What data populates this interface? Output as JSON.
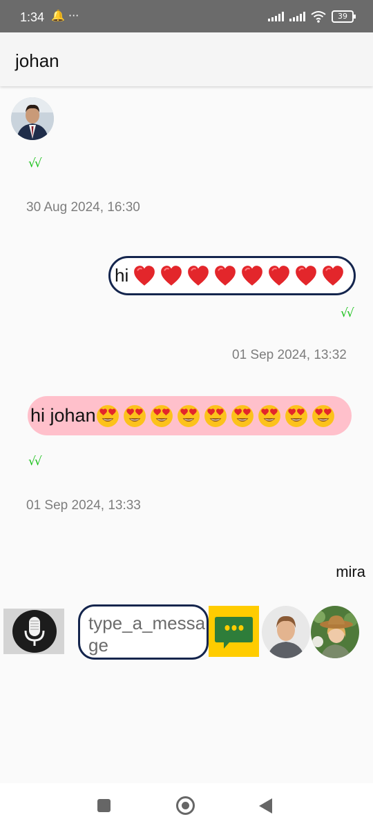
{
  "status_bar": {
    "time": "1:34",
    "left_icons": "🔔 ···",
    "battery": "39"
  },
  "header": {
    "title": "johan"
  },
  "messages": [
    {
      "ticks": "√√",
      "timestamp": "30 Aug 2024, 16:30"
    },
    {
      "text": "hi",
      "emoji": "❤️",
      "emoji_count": 8,
      "ticks": "√√",
      "timestamp": "01 Sep 2024, 13:32"
    },
    {
      "text": "hi johan",
      "emoji": "😍",
      "emoji_count": 9,
      "ticks": "√√",
      "timestamp": "01 Sep 2024, 13:33"
    }
  ],
  "peer_label": "mira",
  "composer": {
    "placeholder": "type_a_message"
  },
  "colors": {
    "bubble_out_border": "#14254d",
    "bubble_in_bg": "#ffc0cb",
    "ticks": "#1dc21d",
    "send_bg": "#ffcc00"
  },
  "icons": [
    "bell-icon",
    "more-icon",
    "signal-icon",
    "wifi-icon",
    "battery-icon",
    "microphone-icon",
    "chat-send-icon",
    "recents-icon",
    "home-icon",
    "back-icon"
  ]
}
